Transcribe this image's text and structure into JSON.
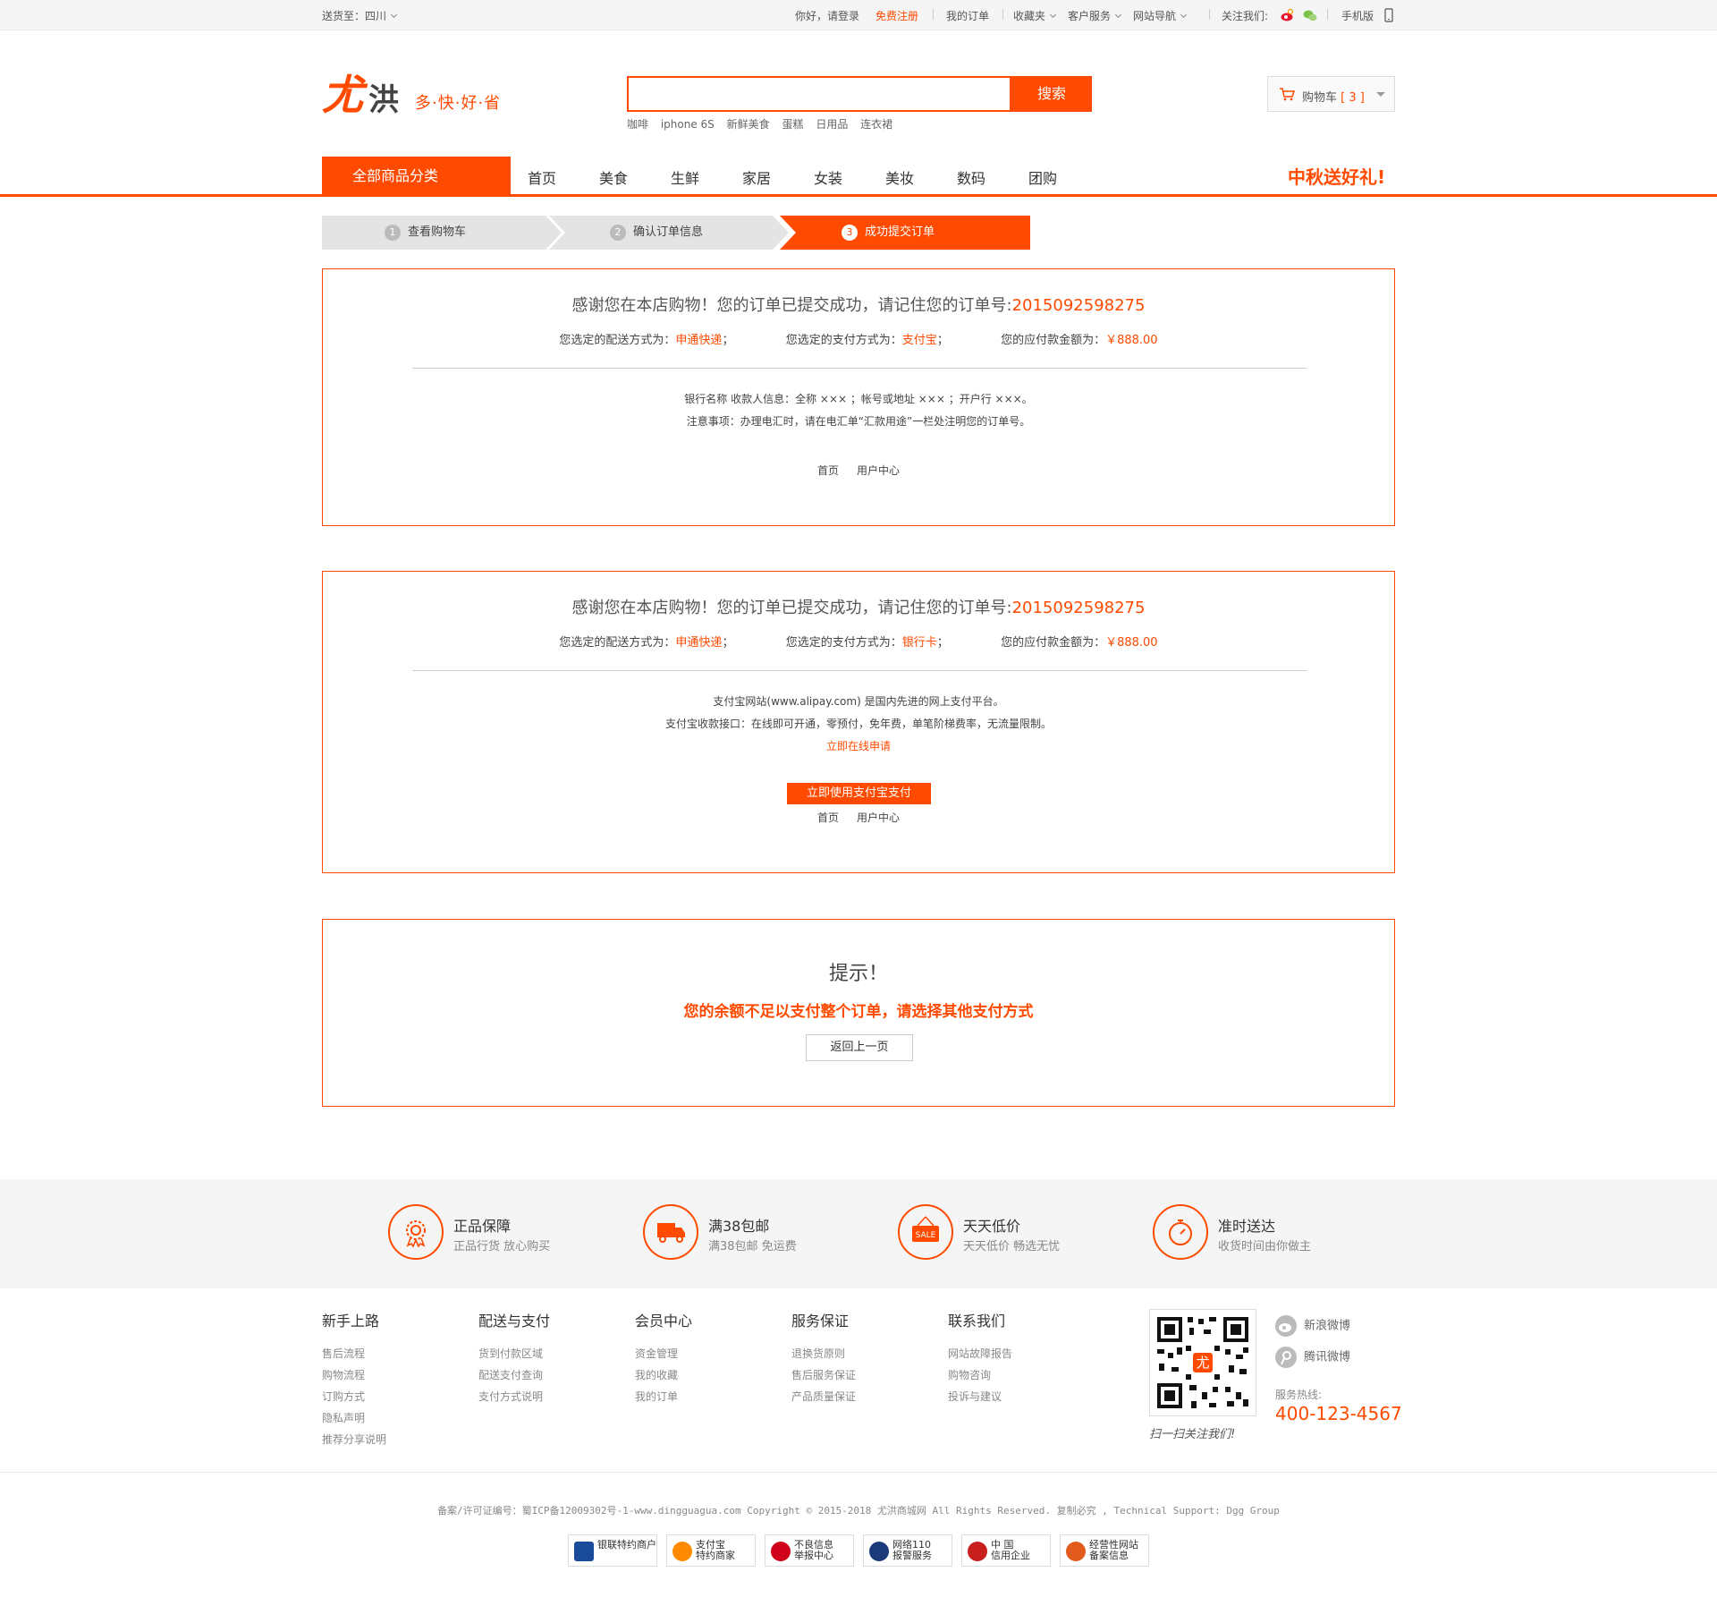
{
  "topbar": {
    "ship_to_label": "送货至：四川",
    "greeting": "你好，请登录",
    "register": "免费注册",
    "my_orders": "我的订单",
    "favorites": "收藏夹",
    "customer_service": "客户服务",
    "site_nav": "网站导航",
    "follow_us": "关注我们:",
    "mobile": "手机版"
  },
  "logo": {
    "brand_a": "尤",
    "brand_b": "洪",
    "slogan": "多·快·好·省"
  },
  "search": {
    "button": "搜索",
    "hot_words": [
      "咖啡",
      "iphone 6S",
      "新鲜美食",
      "蛋糕",
      "日用品",
      "连衣裙"
    ]
  },
  "cart": {
    "label": "购物车",
    "count": "[ 3 ]"
  },
  "nav": {
    "all_categories": "全部商品分类",
    "items": [
      "首页",
      "美食",
      "生鲜",
      "家居",
      "女装",
      "美妆",
      "数码",
      "团购"
    ],
    "promo": "中秋送好礼!"
  },
  "steps": [
    {
      "num": "1",
      "label": "查看购物车"
    },
    {
      "num": "2",
      "label": "确认订单信息"
    },
    {
      "num": "3",
      "label": "成功提交订单"
    }
  ],
  "order1": {
    "title_prefix": "感谢您在本店购物！您的订单已提交成功，请记住您的订单号:",
    "order_no": "2015092598275",
    "shipping_label": "您选定的配送方式为：",
    "shipping_value": "申通快递",
    "payment_label": "您选定的支付方式为：",
    "payment_value": "支付宝",
    "amount_label": "您的应付款金额为：",
    "amount_value": "￥888.00",
    "sep": "；",
    "bank_info": "银行名称 收款人信息：全称 ××× ；帐号或地址 ××× ；开户行 ×××。",
    "notice": "注意事项：办理电汇时，请在电汇单“汇款用途”一栏处注明您的订单号。",
    "link_home": "首页",
    "link_user": "用户中心"
  },
  "order2": {
    "title_prefix": "感谢您在本店购物！您的订单已提交成功，请记住您的订单号:",
    "order_no": "2015092598275",
    "shipping_label": "您选定的配送方式为：",
    "shipping_value": "申通快递",
    "payment_label": "您选定的支付方式为：",
    "payment_value": "银行卡",
    "amount_label": "您的应付款金额为：",
    "amount_value": "￥888.00",
    "sep": "；",
    "alipay_intro": "支付宝网站(www.alipay.com) 是国内先进的网上支付平台。",
    "alipay_interface": "支付宝收款接口：在线即可开通，零预付，免年费，单笔阶梯费率，无流量限制。",
    "apply_now": "立即在线申请",
    "pay_button": "立即使用支付宝支付",
    "link_home": "首页",
    "link_user": "用户中心"
  },
  "tip": {
    "title": "提示！",
    "message": "您的余额不足以支付整个订单，请选择其他支付方式",
    "back_button": "返回上一页"
  },
  "services": [
    {
      "title": "正品保障",
      "desc": "正品行货 放心购买"
    },
    {
      "title": "满38包邮",
      "desc": "满38包邮 免运费"
    },
    {
      "title": "天天低价",
      "desc": "天天低价 畅选无忧"
    },
    {
      "title": "准时送达",
      "desc": "收货时间由你做主"
    }
  ],
  "service_icons": {
    "sale_text": "SALE"
  },
  "footer_cols": [
    {
      "title": "新手上路",
      "items": [
        "售后流程",
        "购物流程",
        "订购方式",
        "隐私声明",
        "推荐分享说明"
      ]
    },
    {
      "title": "配送与支付",
      "items": [
        "货到付款区域",
        "配送支付查询",
        "支付方式说明"
      ]
    },
    {
      "title": "会员中心",
      "items": [
        "资金管理",
        "我的收藏",
        "我的订单"
      ]
    },
    {
      "title": "服务保证",
      "items": [
        "退换货原则",
        "售后服务保证",
        "产品质量保证"
      ]
    },
    {
      "title": "联系我们",
      "items": [
        "网站故障报告",
        "购物咨询",
        "投诉与建议"
      ]
    }
  ],
  "qr": {
    "center": "尤",
    "caption": "扫一扫关注我们!"
  },
  "social": {
    "weibo": "新浪微博",
    "tencent": "腾讯微博"
  },
  "hotline": {
    "label": "服务热线:",
    "number": "400-123-4567"
  },
  "copyright": "备案/许可证编号：蜀ICP备12009302号-1-www.dingguagua.com Copyright © 2015-2018 尤洪商城网 All Rights Reserved. 复制必究 , Technical Support: Dgg Group",
  "badges": [
    {
      "line1": "银联特约商户",
      "line2": "",
      "color": "#1a4b9b"
    },
    {
      "line1": "支付宝",
      "line2": "特约商家",
      "color": "#ff8a00"
    },
    {
      "line1": "不良信息",
      "line2": "举报中心",
      "color": "#d0021b"
    },
    {
      "line1": "网络110",
      "line2": "报警服务",
      "color": "#1a3a7a"
    },
    {
      "line1": "中 国",
      "line2": "信用企业",
      "color": "#c81e1e"
    },
    {
      "line1": "经营性网站",
      "line2": "备案信息",
      "color": "#e25a1c"
    }
  ],
  "colors": {
    "accent": "#ff4a00"
  }
}
